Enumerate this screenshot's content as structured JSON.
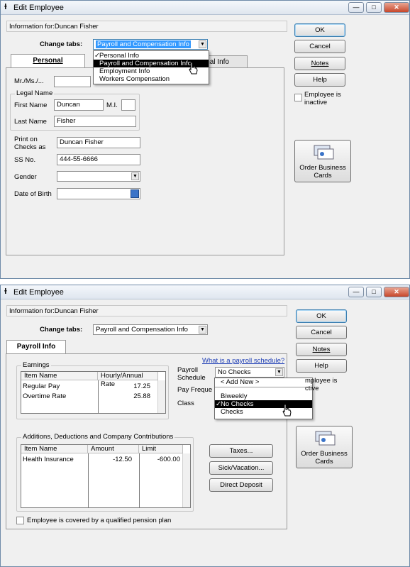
{
  "top": {
    "title": "Edit Employee",
    "info_label": "Information for:",
    "info_name": "Duncan Fisher",
    "change_tabs_label": "Change tabs:",
    "change_tabs_value": "Payroll and Compensation Info",
    "dropdown_items": [
      "Personal Info",
      "Payroll and Compensation Info",
      "Employment Info",
      "Workers Compensation"
    ],
    "dropdown_checked": "✓",
    "tab_personal": "Personal",
    "tab_other_partial": "nal Info",
    "mr_label": "Mr./Ms./...",
    "legal_name_label": "Legal Name",
    "first_name_label": "First Name",
    "first_name_value": "Duncan",
    "mi_label": "M.I.",
    "last_name_label": "Last Name",
    "last_name_value": "Fisher",
    "print_on_checks_label1": "Print on",
    "print_on_checks_label2": "Checks as",
    "print_on_checks_value": "Duncan Fisher",
    "ss_label": "SS No.",
    "ss_value": "444-55-6666",
    "gender_label": "Gender",
    "dob_label": "Date of Birth",
    "ok": "OK",
    "cancel": "Cancel",
    "notes": "Notes",
    "help": "Help",
    "inactive_label1": "Employee is",
    "inactive_label2": "inactive",
    "order_cards1": "Order Business",
    "order_cards2": "Cards"
  },
  "bottom": {
    "title": "Edit Employee",
    "info_label": "Information for:",
    "info_name": "Duncan Fisher",
    "change_tabs_label": "Change tabs:",
    "change_tabs_value": "Payroll and Compensation Info",
    "tab_payroll": "Payroll Info",
    "schedule_link": "What is a payroll schedule?",
    "earnings_label": "Earnings",
    "earnings_headers": [
      "Item Name",
      "Hourly/Annual Rate"
    ],
    "earnings_rows": [
      {
        "name": "Regular Pay",
        "rate": "17.25"
      },
      {
        "name": "Overtime Rate",
        "rate": "25.88"
      }
    ],
    "payroll_schedule_label1": "Payroll",
    "payroll_schedule_label2": "Schedule",
    "payroll_schedule_value": "No Checks",
    "pay_frequency_label": "Pay Freque",
    "class_label": "Class",
    "schedule_menu": {
      "add_new": "< Add New >",
      "items": [
        "Biweekly",
        "No Checks",
        "Checks"
      ],
      "checked": "✓"
    },
    "deductions_label": "Additions, Deductions and Company Contributions",
    "deductions_headers": [
      "Item Name",
      "Amount",
      "Limit"
    ],
    "deductions_rows": [
      {
        "name": "Health Insurance",
        "amount": "-12.50",
        "limit": "-600.00"
      }
    ],
    "taxes": "Taxes...",
    "sick_vacation": "Sick/Vacation...",
    "direct_deposit": "Direct Deposit",
    "pension_label": "Employee is covered by a qualified pension plan",
    "ok": "OK",
    "cancel": "Cancel",
    "notes": "Notes",
    "help": "Help",
    "inactive_label1": "mployee is",
    "inactive_label2": "ctive",
    "order_cards1": "Order Business",
    "order_cards2": "Cards"
  }
}
